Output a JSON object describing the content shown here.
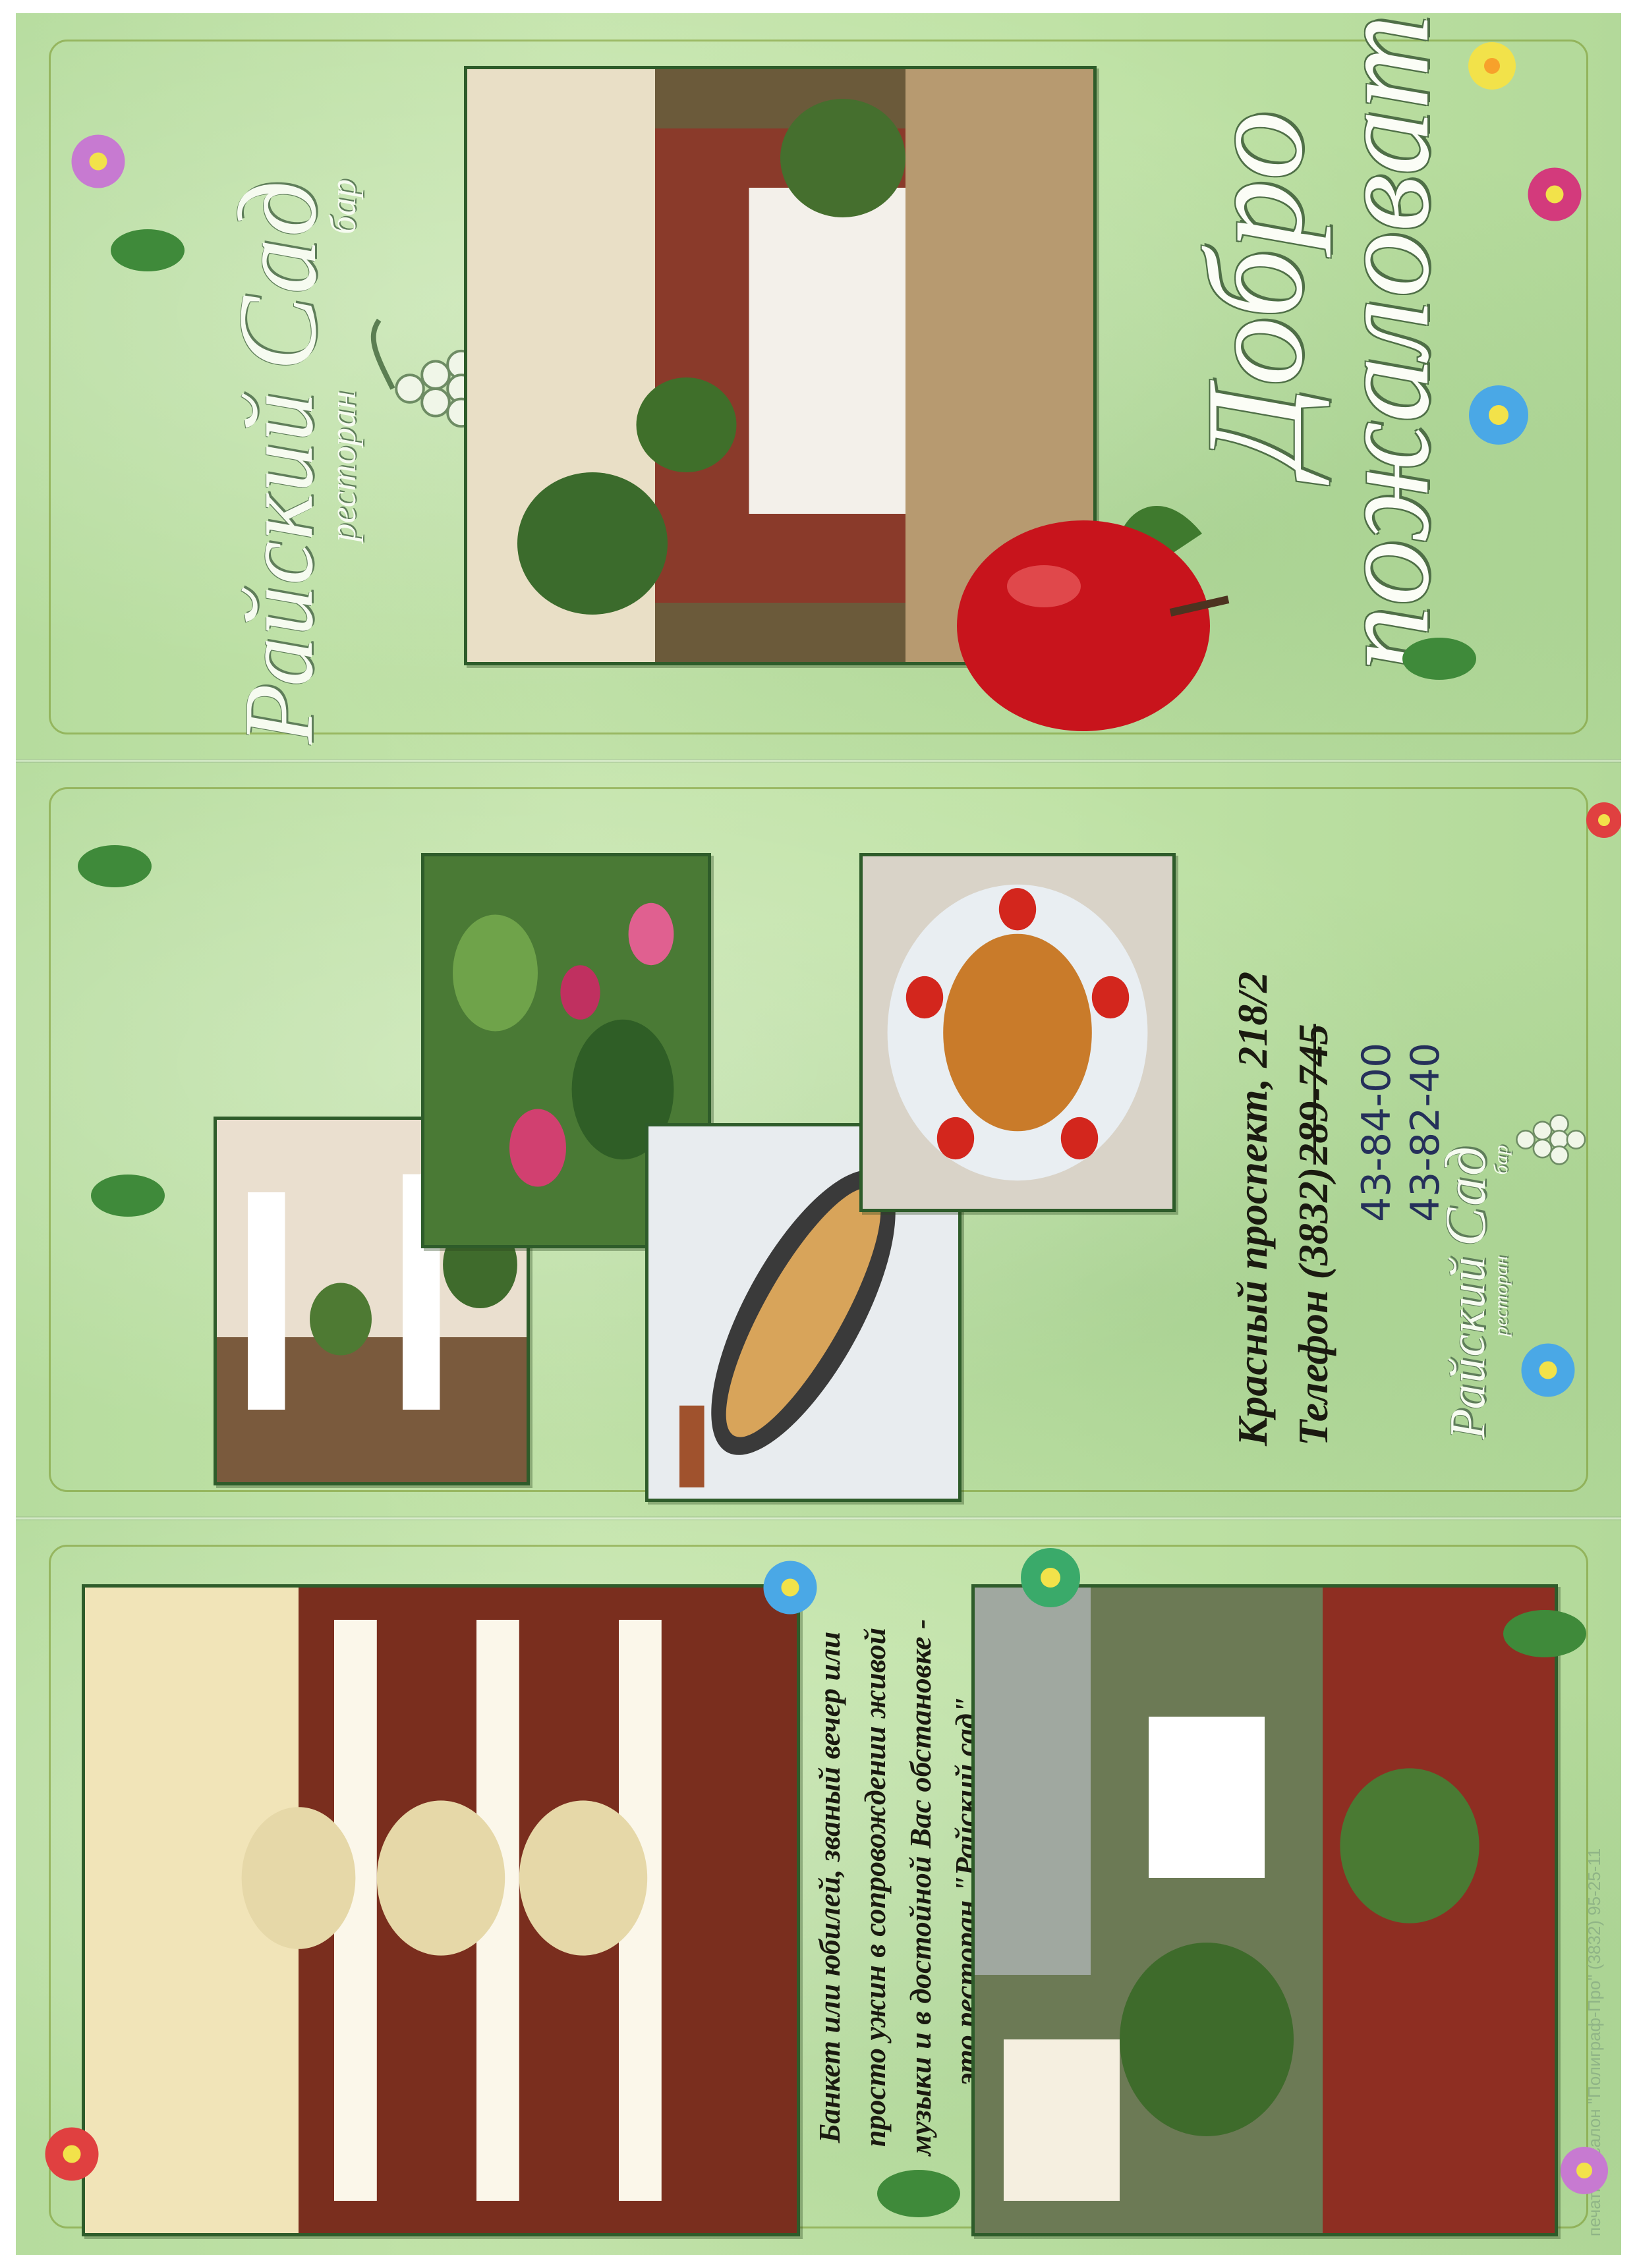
{
  "brand": {
    "name_part1": "Райский",
    "name_part2": "Сад",
    "restaurant_label": "ресторан",
    "bar_label": "бар"
  },
  "cover": {
    "greeting_line1": "Добро",
    "greeting_line2": "пожаловать!"
  },
  "contacts": {
    "address": "Красный проспект, 218/2",
    "phone_prefix": "Телефон (3832)",
    "phone_old": "289-745",
    "phone_new_1": "43-84-00",
    "phone_new_2": "43-82-40"
  },
  "promo": {
    "line1": "Банкет или юбилей, званый вечер или",
    "line2": "просто ужин в сопровождении живой",
    "line3": "музыки и в достойной Вас обстановке -",
    "line4": "это ресторан \"Райский сад\"."
  },
  "printer": {
    "imprint": "печатный салон \"Полиграф-Про\" (3832) 95-25-11"
  },
  "photos": [
    {
      "caption": "restaurant-interior-photo"
    },
    {
      "caption": "dining-terrace-photo"
    },
    {
      "caption": "garden-flowers-photo"
    },
    {
      "caption": "fish-dish-photo"
    },
    {
      "caption": "roast-chicken-dish-photo"
    },
    {
      "caption": "columned-hall-photo"
    },
    {
      "caption": "garden-corner-photo"
    }
  ],
  "colors": {
    "background": "#c4e4ab",
    "photo_border": "#2e5c2a",
    "apple": "#c8141c"
  }
}
